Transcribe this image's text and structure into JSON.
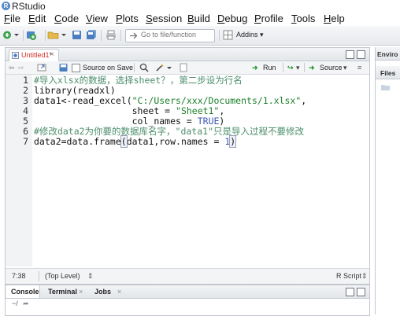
{
  "app": {
    "title": "RStudio"
  },
  "menu": [
    {
      "label": "File",
      "key": "F",
      "rest": "ile"
    },
    {
      "label": "Edit",
      "key": "E",
      "rest": "dit"
    },
    {
      "label": "Code",
      "key": "C",
      "rest": "ode"
    },
    {
      "label": "View",
      "key": "V",
      "rest": "iew"
    },
    {
      "label": "Plots",
      "key": "P",
      "rest": "lots"
    },
    {
      "label": "Session",
      "key": "S",
      "rest": "ession"
    },
    {
      "label": "Build",
      "key": "B",
      "rest": "uild"
    },
    {
      "label": "Debug",
      "key": "D",
      "rest": "ebug"
    },
    {
      "label": "Profile",
      "key": "P",
      "rest": "rofile"
    },
    {
      "label": "Tools",
      "key": "T",
      "rest": "ools"
    },
    {
      "label": "Help",
      "key": "H",
      "rest": "elp"
    }
  ],
  "toolbar": {
    "goto_placeholder": "Go to file/function",
    "addins_label": "Addins"
  },
  "editor": {
    "tab_label": "Untitled1*",
    "source_on_save_label": "Source on Save",
    "run_label": "Run",
    "source_label": "Source",
    "lines": [
      {
        "num": "1",
        "text": "#导入xlsx的数据，选择sheet？，第二步设为行名"
      },
      {
        "num": "2",
        "text": "library(readxl)"
      },
      {
        "num": "3",
        "pre": "data1<-read_excel(",
        "str": "\"C:/Users/xxx/Documents/1.xlsx\"",
        "post": ","
      },
      {
        "num": "4",
        "pre": "                  sheet = ",
        "str": "\"Sheet1\"",
        "post": ","
      },
      {
        "num": "5",
        "pre": "                  col_names = ",
        "kw": "TRUE",
        "post": ")"
      },
      {
        "num": "6",
        "text": "#修改data2为你要的数据库名字，\"data1\"只是导入过程不要修改"
      },
      {
        "num": "7",
        "pre": "data2=data.frame",
        "paren": "(",
        "mid": "data1,row.names = ",
        "kw": "1",
        "post": ")"
      }
    ]
  },
  "status": {
    "position": "7:38",
    "scope": "(Top Level)",
    "filetype": "R Script"
  },
  "console": {
    "tabs": [
      "Console",
      "Terminal",
      "Jobs"
    ],
    "path": "~/"
  },
  "right_pane": {
    "tabs": [
      "Enviro",
      "Files"
    ]
  },
  "colors": {
    "comment": "#4c8e6b",
    "string": "#1d7f2b",
    "keyword": "#3a58b5",
    "tab_modified": "#d0332c"
  }
}
